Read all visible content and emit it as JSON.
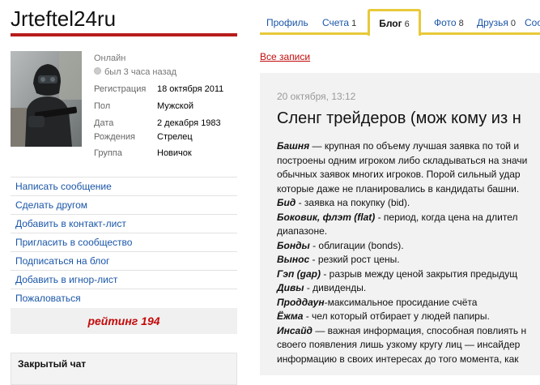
{
  "profile": {
    "username": "Jrteftel24ru",
    "status_online": "Онлайн",
    "status_seen": "был 3 часа назад",
    "info": [
      {
        "label": "Регистрация",
        "value": "18 октября 2011"
      },
      {
        "label": "Пол",
        "value": "Мужской"
      },
      {
        "label": "Дата",
        "value": "2 декабря 1983"
      },
      {
        "label": "Рождения",
        "value": "Стрелец"
      },
      {
        "label": "Группа",
        "value": "Новичок"
      }
    ]
  },
  "actions": [
    "Написать сообщение",
    "Сделать другом",
    "Добавить в контакт-лист",
    "Пригласить в сообщество",
    "Подписаться на блог",
    "Добавить в игнор-лист",
    "Пожаловаться"
  ],
  "rating": "рейтинг 194",
  "chat": {
    "title": "Закрытый чат"
  },
  "tabs": [
    {
      "label": "Профиль",
      "count": ""
    },
    {
      "label": "Счета",
      "count": "1"
    },
    {
      "label": "Блог",
      "count": "6"
    },
    {
      "label": "Фото",
      "count": "8"
    },
    {
      "label": "Друзья",
      "count": "0"
    },
    {
      "label": "Сооб",
      "count": ""
    }
  ],
  "blog": {
    "all_posts": "Все записи",
    "post": {
      "date": "20 октября, 13:12",
      "title": "Сленг трейдеров (мож кому из н",
      "lines": [
        {
          "term": "Башня",
          "text": " — крупная по объему лучшая заявка по той и"
        },
        {
          "term": "",
          "text": "построены одним игроком либо складываться на значи"
        },
        {
          "term": "",
          "text": "обычных заявок многих игроков. Порой сильный удар"
        },
        {
          "term": "",
          "text": "которые даже не планировались в кандидаты башни."
        },
        {
          "term": "Бид",
          "text": " - заявка на покупку (bid)."
        },
        {
          "term": "Боковик, флэт (flat)",
          "text": " - период, когда цена на длител"
        },
        {
          "term": "",
          "text": "диапазоне."
        },
        {
          "term": "Бонды",
          "text": " - облигации (bonds)."
        },
        {
          "term": "Вынос",
          "text": " - резкий рост цены."
        },
        {
          "term": "Гэп (gap)",
          "text": " - разрыв между ценой закрытия предыдущ"
        },
        {
          "term": "Дивы",
          "text": " - дивиденды."
        },
        {
          "term": "Проддаун",
          "text": "-максимальное просидание счёта"
        },
        {
          "term": "Ёжма",
          "text": " - чел который отбирает у людей папиры."
        },
        {
          "term": "Инсайд",
          "text": " — важная информация, способная повлиять н"
        },
        {
          "term": "",
          "text": "своего появления лишь узкому кругу лиц — инсайдер"
        },
        {
          "term": "",
          "text": "информацию в своих интересах до того момента, как"
        }
      ]
    }
  },
  "colors": {
    "accent_red": "#b81c1c",
    "link_blue": "#1a56a8",
    "tab_yellow": "#e8c93a",
    "rating_red": "#c30b0b"
  }
}
